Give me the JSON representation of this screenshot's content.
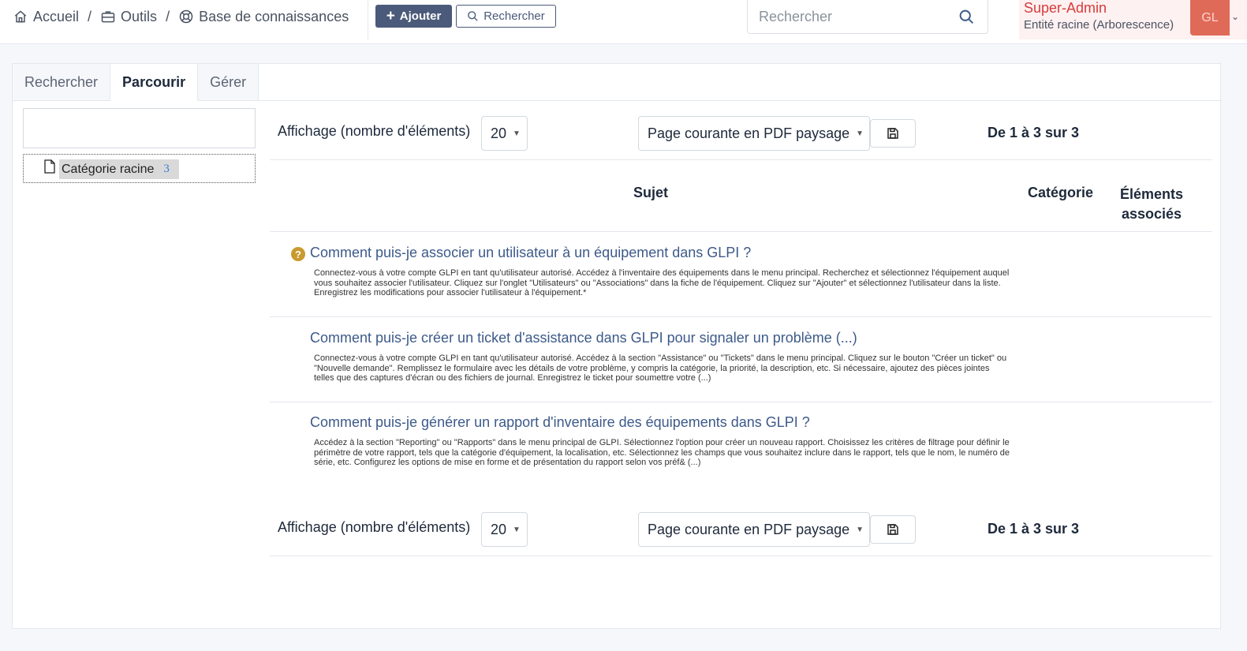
{
  "header": {
    "breadcrumb": [
      {
        "label": "Accueil",
        "icon": "home-icon"
      },
      {
        "label": "Outils",
        "icon": "briefcase-icon"
      },
      {
        "label": "Base de connaissances",
        "icon": "lifebuoy-icon"
      }
    ],
    "breadcrumb_separator": "/",
    "add_button_label": "Ajouter",
    "search_button_label": "Rechercher",
    "search_placeholder": "Rechercher",
    "user_name": "Super-Admin",
    "user_entity": "Entité racine (Arborescence)",
    "avatar_initials": "GL"
  },
  "tabs": [
    {
      "label": "Rechercher",
      "active": false
    },
    {
      "label": "Parcourir",
      "active": true
    },
    {
      "label": "Gérer",
      "active": false
    }
  ],
  "tree": {
    "node_label": "Catégorie racine",
    "node_count": "3"
  },
  "pager": {
    "display_label": "Affichage (nombre d'éléments)",
    "page_size": "20",
    "export_option": "Page courante en PDF paysage",
    "count_text": "De 1 à 3 sur 3"
  },
  "table": {
    "columns": [
      "Sujet",
      "Catégorie",
      "Éléments associés"
    ],
    "rows": [
      {
        "title": "Comment puis-je associer un utilisateur à un équipement dans GLPI ?",
        "description": "Connectez-vous à votre compte GLPI en tant qu'utilisateur autorisé. Accédez à l'inventaire des équipements dans le menu principal. Recherchez et sélectionnez l'équipement auquel vous souhaitez associer l'utilisateur. Cliquez sur l'onglet \"Utilisateurs\" ou \"Associations\" dans la fiche de l'équipement. Cliquez sur \"Ajouter\" et sélectionnez l'utilisateur dans la liste. Enregistrez les modifications pour associer l'utilisateur à l'équipement.*",
        "faq_icon": true
      },
      {
        "title": "Comment puis-je créer un ticket d'assistance dans GLPI pour signaler un problème (...)",
        "description": "Connectez-vous à votre compte GLPI en tant qu'utilisateur autorisé. Accédez à la section \"Assistance\" ou \"Tickets\" dans le menu principal. Cliquez sur le bouton \"Créer un ticket\" ou \"Nouvelle demande\". Remplissez le formulaire avec les détails de votre problème, y compris la catégorie, la priorité, la description, etc. Si nécessaire, ajoutez des pièces jointes telles que des captures d'écran ou des fichiers de journal. Enregistrez le ticket pour soumettre votre  (...)",
        "faq_icon": false
      },
      {
        "title": "Comment puis-je générer un rapport d'inventaire des équipements dans GLPI ?",
        "description": "Accédez à la section \"Reporting\" ou \"Rapports\" dans le menu principal de GLPI. Sélectionnez l'option pour créer un nouveau rapport. Choisissez les critères de filtrage pour définir le périmètre de votre rapport, tels que la catégorie d'équipement, la localisation, etc. Sélectionnez les champs que vous souhaitez inclure dans le rapport, tels que le nom, le numéro de série, etc. Configurez les options de mise en forme et de présentation du rapport selon vos préf& (...)",
        "faq_icon": false
      }
    ]
  },
  "colors": {
    "primary_button": "#4b5a7a",
    "link": "#3d5a8a",
    "user_name": "#d63c3c",
    "avatar_bg": "#e06a58",
    "faq_icon": "#c99a2e"
  }
}
